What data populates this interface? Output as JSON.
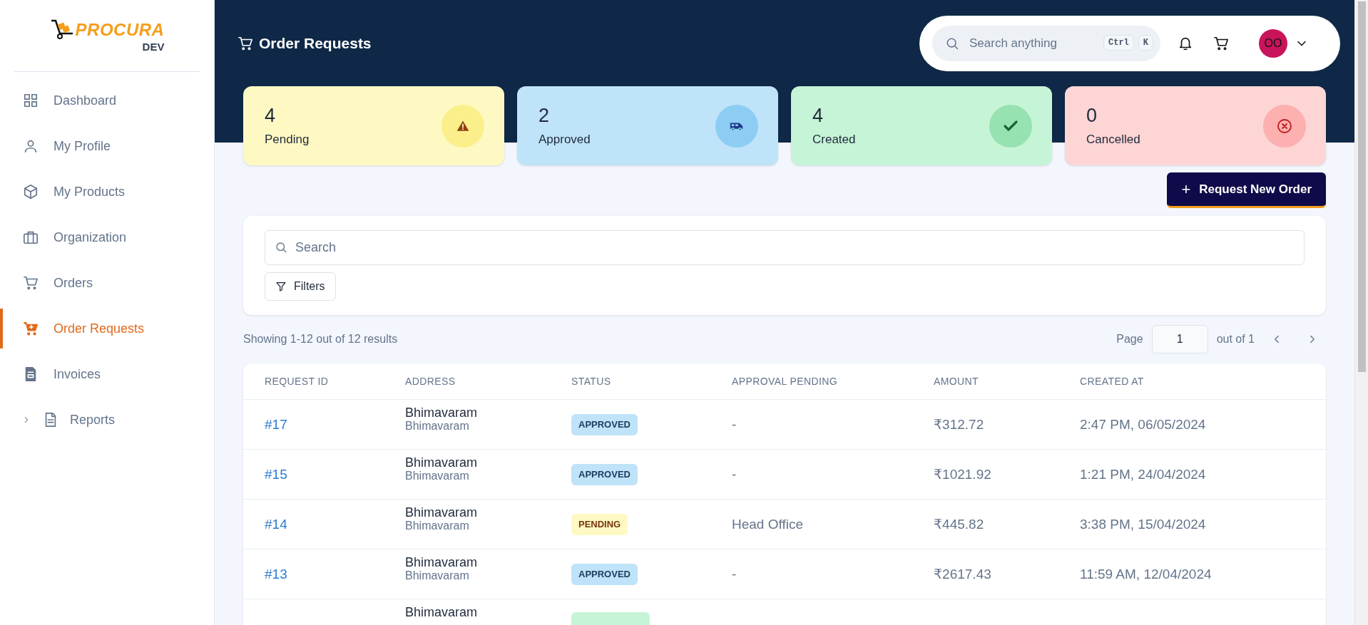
{
  "sidebar": {
    "logo": {
      "name": "PROCURA",
      "badge": "DEV"
    },
    "items": [
      {
        "label": "Dashboard",
        "selected": false
      },
      {
        "label": "My Profile",
        "selected": false
      },
      {
        "label": "My Products",
        "selected": false
      },
      {
        "label": "Organization",
        "selected": false
      },
      {
        "label": "Orders",
        "selected": false
      },
      {
        "label": "Order Requests",
        "selected": true
      },
      {
        "label": "Invoices",
        "selected": false
      },
      {
        "label": "Reports",
        "selected": false,
        "expanded": false
      }
    ]
  },
  "header": {
    "title": "Order Requests",
    "search": {
      "placeholder": "Search anything",
      "keys": [
        "Ctrl",
        "K"
      ]
    },
    "avatar": "OO"
  },
  "stats": [
    {
      "value": "4",
      "label": "Pending",
      "kind": "pending"
    },
    {
      "value": "2",
      "label": "Approved",
      "kind": "approved"
    },
    {
      "value": "4",
      "label": "Created",
      "kind": "created"
    },
    {
      "value": "0",
      "label": "Cancelled",
      "kind": "cancelled"
    }
  ],
  "new_order_button": {
    "icon": "+",
    "label": "Request New Order"
  },
  "filter_panel": {
    "search_placeholder": "Search",
    "filters_button": "Filters"
  },
  "results": {
    "summary": "Showing 1-12 out of 12 results",
    "page_label": "Page",
    "page_value": "1",
    "page_total": "out of 1"
  },
  "table": {
    "columns": [
      "REQUEST ID",
      "ADDRESS",
      "STATUS",
      "APPROVAL PENDING",
      "AMOUNT",
      "CREATED AT"
    ],
    "rows": [
      {
        "id": "#17",
        "address": [
          "Bhimavaram",
          "Bhimavaram"
        ],
        "status": {
          "label": "APPROVED",
          "kind": "approved"
        },
        "approval": "-",
        "amount": "₹312.72",
        "created": "2:47 PM, 06/05/2024"
      },
      {
        "id": "#15",
        "address": [
          "Bhimavaram",
          "Bhimavaram"
        ],
        "status": {
          "label": "APPROVED",
          "kind": "approved"
        },
        "approval": "-",
        "amount": "₹1021.92",
        "created": "1:21 PM, 24/04/2024"
      },
      {
        "id": "#14",
        "address": [
          "Bhimavaram",
          "Bhimavaram"
        ],
        "status": {
          "label": "PENDING",
          "kind": "pending"
        },
        "approval": "Head Office",
        "amount": "₹445.82",
        "created": "3:38 PM, 15/04/2024"
      },
      {
        "id": "#13",
        "address": [
          "Bhimavaram",
          "Bhimavaram"
        ],
        "status": {
          "label": "APPROVED",
          "kind": "approved"
        },
        "approval": "-",
        "amount": "₹2617.43",
        "created": "11:59 AM, 12/04/2024"
      },
      {
        "address": [
          "Bhimavaram"
        ],
        "status": {
          "kind": "created"
        }
      }
    ]
  }
}
